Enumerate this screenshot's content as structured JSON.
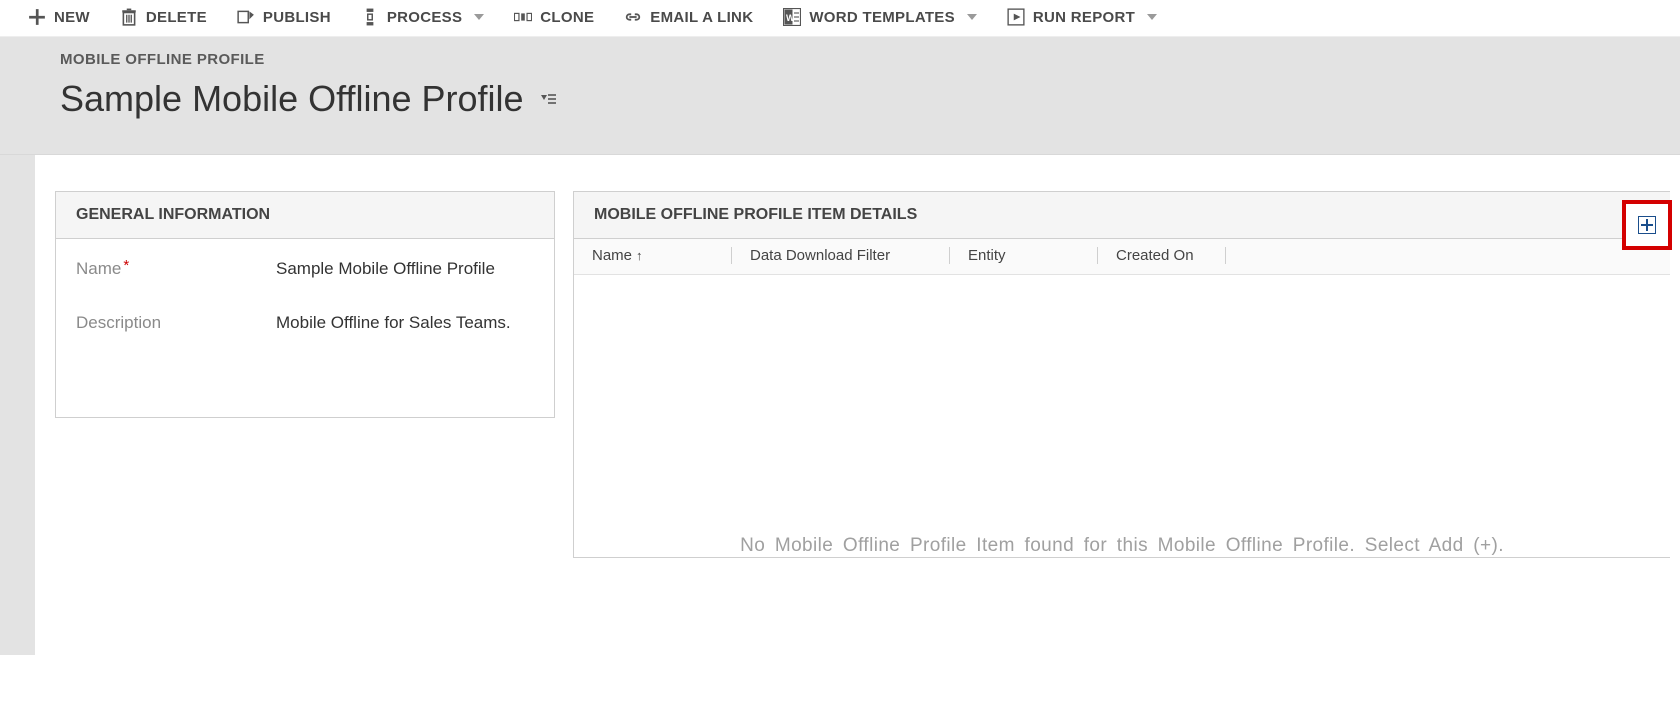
{
  "commands": {
    "new": "NEW",
    "delete": "DELETE",
    "publish": "PUBLISH",
    "process": "PROCESS",
    "clone": "CLONE",
    "email": "EMAIL A LINK",
    "word": "WORD TEMPLATES",
    "report": "RUN REPORT"
  },
  "header": {
    "entity": "MOBILE OFFLINE PROFILE",
    "title": "Sample Mobile Offline Profile"
  },
  "general": {
    "section_title": "GENERAL INFORMATION",
    "name_label": "Name",
    "name_value": "Sample Mobile Offline Profile",
    "desc_label": "Description",
    "desc_value": "Mobile Offline for Sales Teams."
  },
  "details": {
    "section_title": "MOBILE OFFLINE PROFILE ITEM DETAILS",
    "columns": {
      "name": "Name",
      "ddf": "Data Download Filter",
      "entity": "Entity",
      "created": "Created On"
    },
    "empty_message": "No Mobile Offline Profile Item found for this Mobile Offline Profile. Select Add (+)."
  }
}
